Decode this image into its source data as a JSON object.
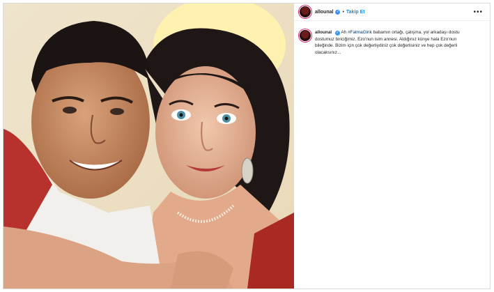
{
  "post": {
    "username": "allounal",
    "separator": "•",
    "follow_label": "Takip Et",
    "more_label": "•••",
    "caption": {
      "username": "allounal",
      "hashtag": "#FatmaGirik",
      "text_before_hashtag": "Ah",
      "text_after_hashtag": "babamın ortağı, çalışma, yol arkadaşı dostu dostumuz biriciğimiz. Ezo'nun isim annesi. Aldığınız künye hala Ezo'nun bileğinde. Bizim için çok değerliydiniz çok değerlisiniz ve hep çok değerli olacaksınız..."
    }
  },
  "colors": {
    "follow": "#0095f6",
    "verified": "#3897f0",
    "hashtag": "#00376b",
    "border": "#dbdbdb"
  },
  "icons": [
    "verified-badge-icon",
    "more-options-icon"
  ]
}
